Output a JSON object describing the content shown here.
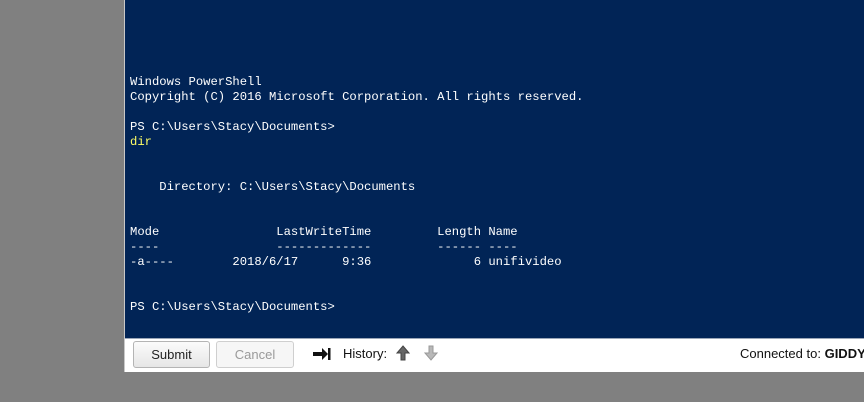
{
  "terminal": {
    "lines": [
      "Windows PowerShell",
      "Copyright (C) 2016 Microsoft Corporation. All rights reserved.",
      "",
      "PS C:\\Users\\Stacy\\Documents>",
      "dir",
      "",
      "",
      "    Directory: C:\\Users\\Stacy\\Documents",
      "",
      "",
      "Mode                LastWriteTime         Length Name",
      "----                -------------         ------ ----",
      "-a----        2018/6/17      9:36              6 unifivideo",
      "",
      "",
      "PS C:\\Users\\Stacy\\Documents>"
    ],
    "colors": {
      "background": "#012456",
      "text": "#ffffff",
      "command": "#ffff66"
    }
  },
  "toolbar": {
    "submit_label": "Submit",
    "cancel_label": "Cancel",
    "tab_icon": "tab-arrow-icon",
    "history_label": "History:",
    "history_up_icon": "arrow-up-icon",
    "history_down_icon": "arrow-down-icon",
    "connected_label": "Connected to:",
    "connected_host": "GIDDY"
  }
}
